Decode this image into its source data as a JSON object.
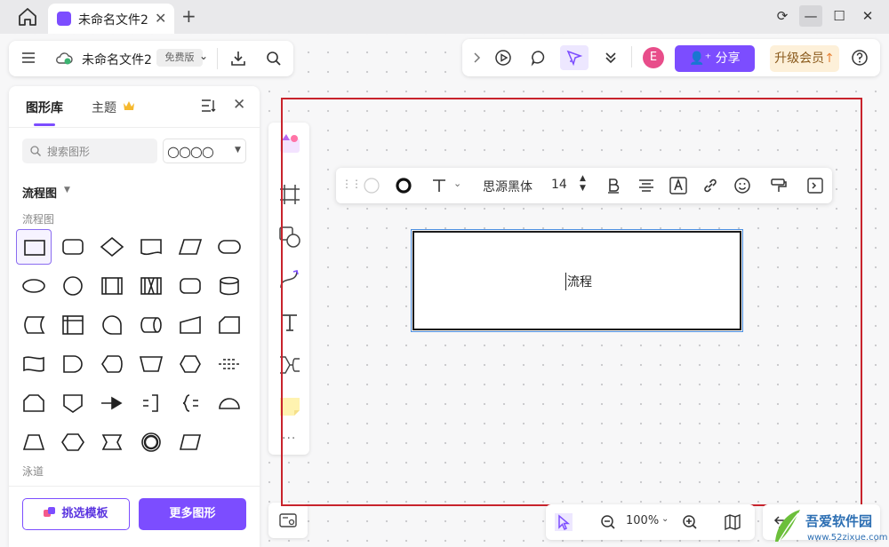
{
  "window": {
    "tab_title": "未命名文件2",
    "tab_close": "✕",
    "tab_add": "+",
    "controls": {
      "refresh": "⟳",
      "minimize": "—",
      "maximize": "☐",
      "close": "✕"
    }
  },
  "header": {
    "file_title": "未命名文件2",
    "plan_badge": "免费版",
    "avatar_letter": "E",
    "share_label": "分享",
    "upgrade_label": "升级会员"
  },
  "library": {
    "tabs": [
      {
        "label": "图形库"
      },
      {
        "label": "主题"
      }
    ],
    "search_placeholder": "搜索图形",
    "style_circles": "○○○○",
    "category_title": "流程图",
    "subcategory_title": "流程图",
    "shapes": [
      "process",
      "terminal-rounded",
      "decision",
      "document",
      "data-io",
      "terminator",
      "ellipse",
      "circle",
      "predefined-process",
      "predefined-process-alt",
      "rounded-rect",
      "database",
      "stored-data",
      "internal-storage",
      "sequential-data",
      "direct-data",
      "manual-input",
      "card",
      "tape",
      "delay",
      "display",
      "manual-operation",
      "preparation",
      "separator",
      "loop-limit",
      "off-page",
      "or-junction",
      "bracket-right",
      "bracket-left",
      "half-circle",
      "trapezoid",
      "hexagon",
      "pentagon-arrow",
      "double-circle",
      "parallelogram"
    ],
    "swimlane_title": "泳道",
    "template_button": "挑选模板",
    "more_button": "更多图形"
  },
  "format_bar": {
    "font_name": "思源黑体",
    "font_size": "14"
  },
  "canvas": {
    "shape_text": "流程"
  },
  "zoom": {
    "value": "100%"
  },
  "watermark": {
    "name": "吾爱软件园",
    "url": "www.52zixue.com"
  },
  "colors": {
    "accent": "#7c4dff",
    "frame": "#c8232c",
    "avatar": "#e84d8a",
    "upgrade_bg": "#fdf0d9"
  }
}
